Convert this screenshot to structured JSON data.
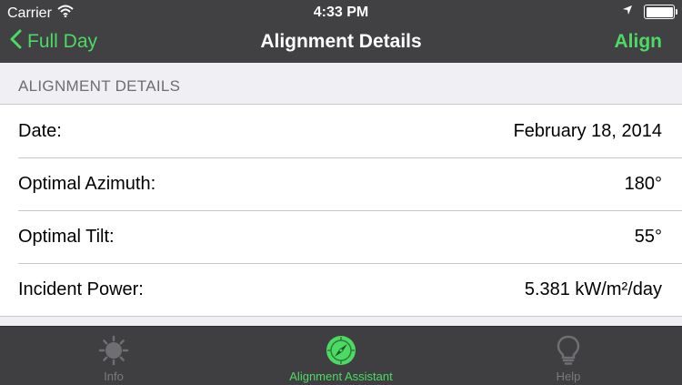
{
  "status_bar": {
    "carrier": "Carrier",
    "time": "4:33 PM",
    "icons": [
      "wifi-icon",
      "location-arrow-icon",
      "battery-icon"
    ]
  },
  "nav": {
    "back_label": "Full Day",
    "title": "Alignment Details",
    "action_label": "Align",
    "accent_color": "#4cd964"
  },
  "section": {
    "header": "ALIGNMENT DETAILS"
  },
  "details": [
    {
      "label": "Date:",
      "value": "February 18, 2014"
    },
    {
      "label": "Optimal Azimuth:",
      "value": "180°"
    },
    {
      "label": "Optimal Tilt:",
      "value": "55°"
    },
    {
      "label": "Incident Power:",
      "value": "5.381 kW/m²/day"
    }
  ],
  "tabs": [
    {
      "label": "Info",
      "icon": "sun-icon",
      "active": false
    },
    {
      "label": "Alignment Assistant",
      "icon": "compass-icon",
      "active": true
    },
    {
      "label": "Help",
      "icon": "lightbulb-icon",
      "active": false
    }
  ]
}
